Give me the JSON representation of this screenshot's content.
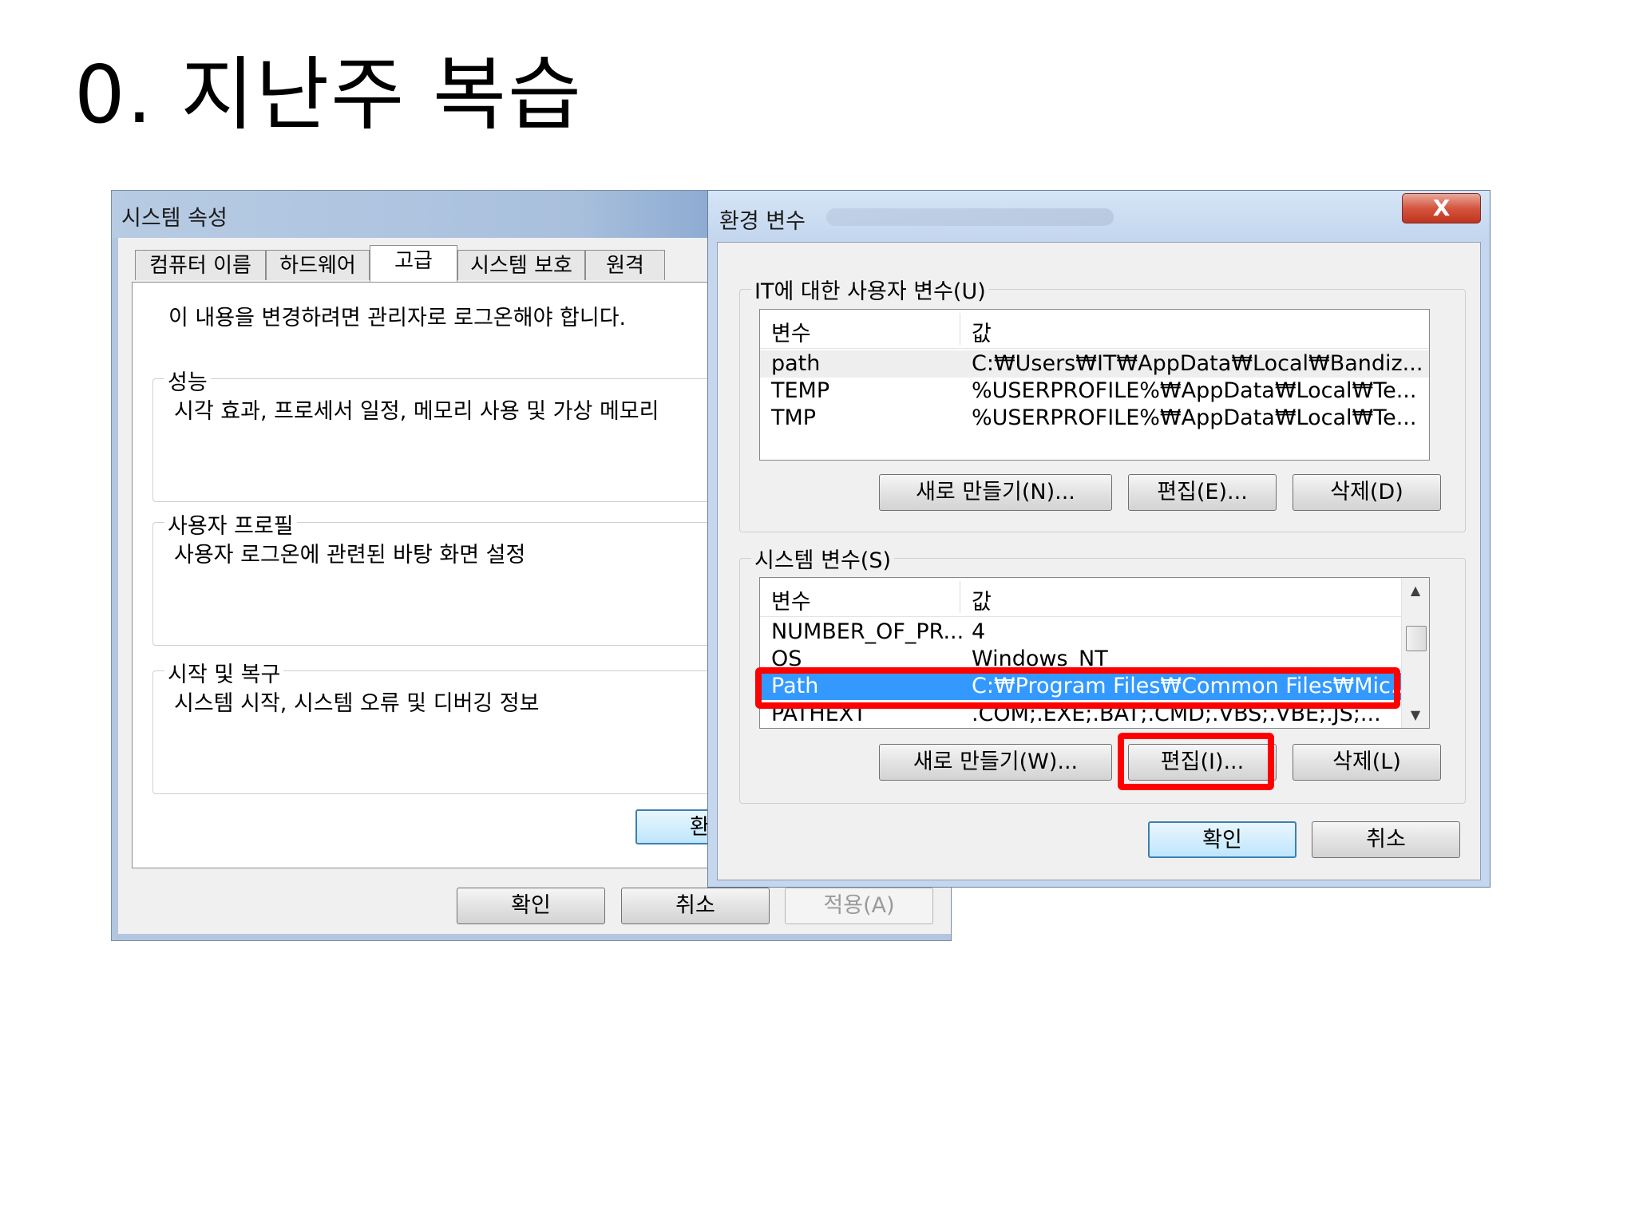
{
  "slide": {
    "title": "0. 지난주 복습"
  },
  "system_properties": {
    "title": "시스템 속성",
    "tabs": [
      "컴퓨터 이름",
      "하드웨어",
      "고급",
      "시스템 보호",
      "원격"
    ],
    "active_tab": "고급",
    "admin_note": "이 내용을 변경하려면 관리자로 로그온해야 합니다.",
    "groups": [
      {
        "legend": "성능",
        "description": "시각 효과, 프로세서 일정, 메모리 사용 및 가상 메모리"
      },
      {
        "legend": "사용자 프로필",
        "description": "사용자 로그온에 관련된 바탕 화면 설정"
      },
      {
        "legend": "시작 및 복구",
        "description": "시스템 시작, 시스템 오류 및 디버깅 정보"
      }
    ],
    "env_button_label": "환",
    "buttons": {
      "ok": "확인",
      "cancel": "취소",
      "apply": "적용(A)"
    }
  },
  "environment_variables": {
    "title": "환경 변수",
    "close_glyph": "X",
    "user_section": {
      "legend": "IT에 대한 사용자 변수(U)",
      "columns": [
        "변수",
        "값"
      ],
      "rows": [
        {
          "name": "path",
          "value": "C:₩Users₩IT₩AppData₩Local₩Bandiz..."
        },
        {
          "name": "TEMP",
          "value": "%USERPROFILE%₩AppData₩Local₩Te..."
        },
        {
          "name": "TMP",
          "value": "%USERPROFILE%₩AppData₩Local₩Te..."
        }
      ],
      "buttons": {
        "new": "새로 만들기(N)...",
        "edit": "편집(E)...",
        "delete": "삭제(D)"
      }
    },
    "system_section": {
      "legend": "시스템 변수(S)",
      "columns": [
        "변수",
        "값"
      ],
      "rows": [
        {
          "name": "NUMBER_OF_PR...",
          "value": "4"
        },
        {
          "name": "OS",
          "value": "Windows_NT"
        },
        {
          "name": "Path",
          "value": "C:₩Program Files₩Common Files₩Mic..."
        },
        {
          "name": "PATHEXT",
          "value": ".COM;.EXE;.BAT;.CMD;.VBS;.VBE;.JS;..."
        }
      ],
      "selected_row": "Path",
      "buttons": {
        "new": "새로 만들기(W)...",
        "edit": "편집(I)...",
        "delete": "삭제(L)"
      }
    },
    "buttons": {
      "ok": "확인",
      "cancel": "취소"
    }
  },
  "colors": {
    "highlight": "#ff0000",
    "selection": "#3399ff"
  }
}
